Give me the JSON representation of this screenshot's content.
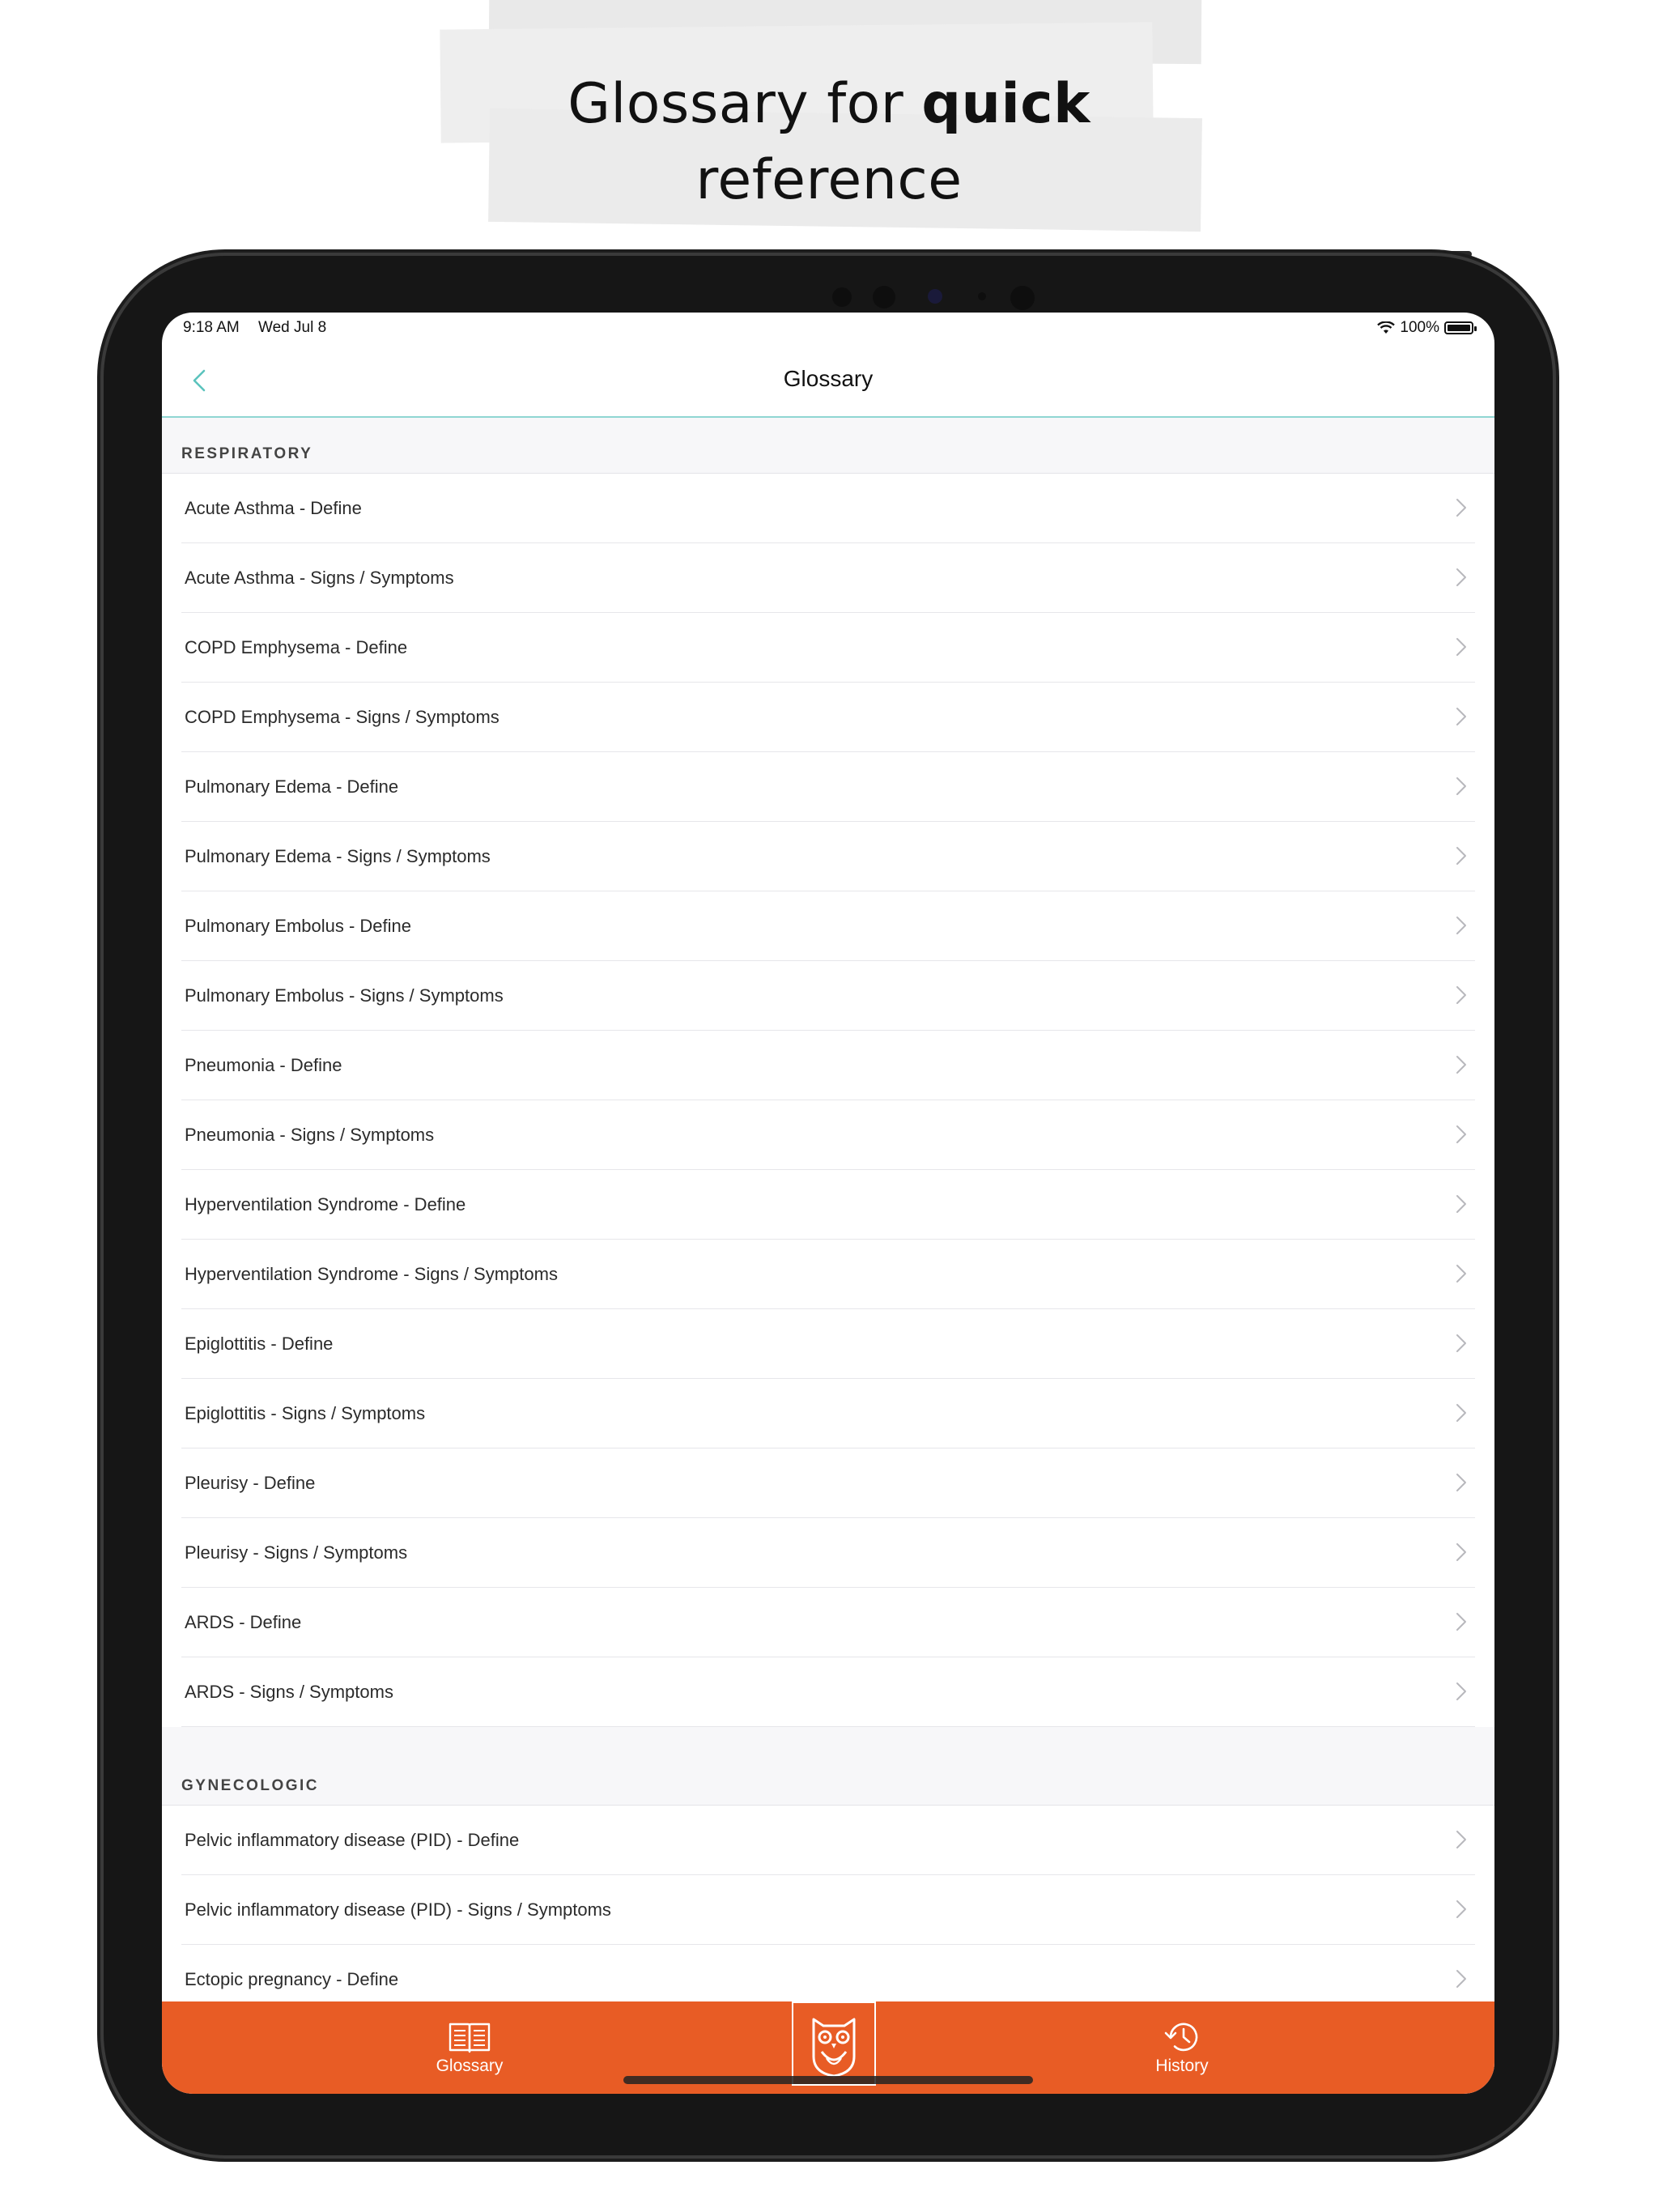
{
  "caption": {
    "line1_prefix": "Glossary for ",
    "line1_bold": "quick",
    "line2": "reference"
  },
  "status_bar": {
    "time": "9:18 AM",
    "date": "Wed Jul 8",
    "battery": "100%"
  },
  "nav": {
    "title": "Glossary"
  },
  "sections": [
    {
      "header": "RESPIRATORY",
      "items": [
        "Acute Asthma - Define",
        "Acute Asthma - Signs / Symptoms",
        "COPD Emphysema - Define",
        "COPD Emphysema - Signs / Symptoms",
        "Pulmonary Edema - Define",
        "Pulmonary Edema - Signs / Symptoms",
        "Pulmonary Embolus - Define",
        "Pulmonary Embolus - Signs / Symptoms",
        "Pneumonia - Define",
        "Pneumonia - Signs / Symptoms",
        "Hyperventilation Syndrome - Define",
        "Hyperventilation Syndrome - Signs / Symptoms",
        "Epiglottitis - Define",
        "Epiglottitis - Signs / Symptoms",
        "Pleurisy - Define",
        "Pleurisy - Signs / Symptoms",
        "ARDS - Define",
        "ARDS - Signs / Symptoms"
      ]
    },
    {
      "header": "GYNECOLOGIC",
      "items": [
        "Pelvic inflammatory disease (PID) - Define",
        "Pelvic inflammatory disease (PID) - Signs / Symptoms",
        "Ectopic pregnancy - Define"
      ]
    }
  ],
  "tab_bar": {
    "glossary_label": "Glossary",
    "history_label": "History",
    "glossary_icon": "book-icon",
    "center_icon": "owl-logo-icon",
    "history_icon": "history-icon"
  },
  "colors": {
    "accent": "#e85c25",
    "nav_divider": "#8fd6d2",
    "back_chevron": "#5bc3bd"
  }
}
